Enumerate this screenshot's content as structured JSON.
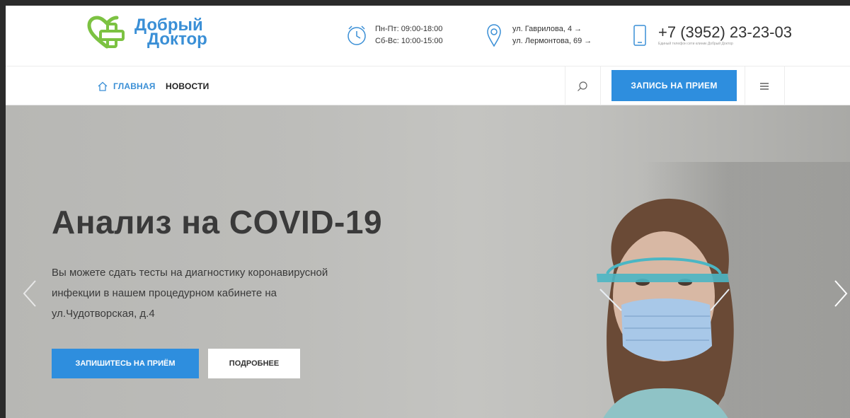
{
  "header": {
    "logo": {
      "line1": "Добрый",
      "line2": "Доктор"
    },
    "hours": {
      "weekdays": "Пн-Пт: 09:00-18:00",
      "weekend": "Сб-Вс: 10:00-15:00"
    },
    "addresses": {
      "address1": "ул. Гаврилова, 4 →",
      "address2": "ул. Лермонтова, 69 →"
    },
    "phone": {
      "number": "+7 (3952) 23-23-03",
      "caption": "Единый телефон сети клиник Добрый Доктор"
    }
  },
  "nav": {
    "items": [
      {
        "label": "ГЛАВНАЯ",
        "active": true
      },
      {
        "label": "НОВОСТИ",
        "active": false
      }
    ],
    "appointment_label": "ЗАПИСЬ НА ПРИЕМ"
  },
  "hero": {
    "title": "Анализ на COVID-19",
    "text": "Вы можете сдать тесты на диагностику коронавирусной инфекции в нашем процедурном кабинете на ул.Чудотворская, д.4",
    "primary_button": "ЗАПИШИТЕСЬ НА ПРИЁМ",
    "secondary_button": "ПОДРОБНЕЕ"
  },
  "colors": {
    "accent": "#2e8ede",
    "logo_green": "#7cc242",
    "logo_blue": "#3a8fd6",
    "text_dark": "#3a3a3a"
  },
  "icons": [
    "clock-icon",
    "map-pin-icon",
    "phone-icon",
    "home-icon",
    "search-icon",
    "menu-icon",
    "chevron-left-icon",
    "chevron-right-icon"
  ]
}
